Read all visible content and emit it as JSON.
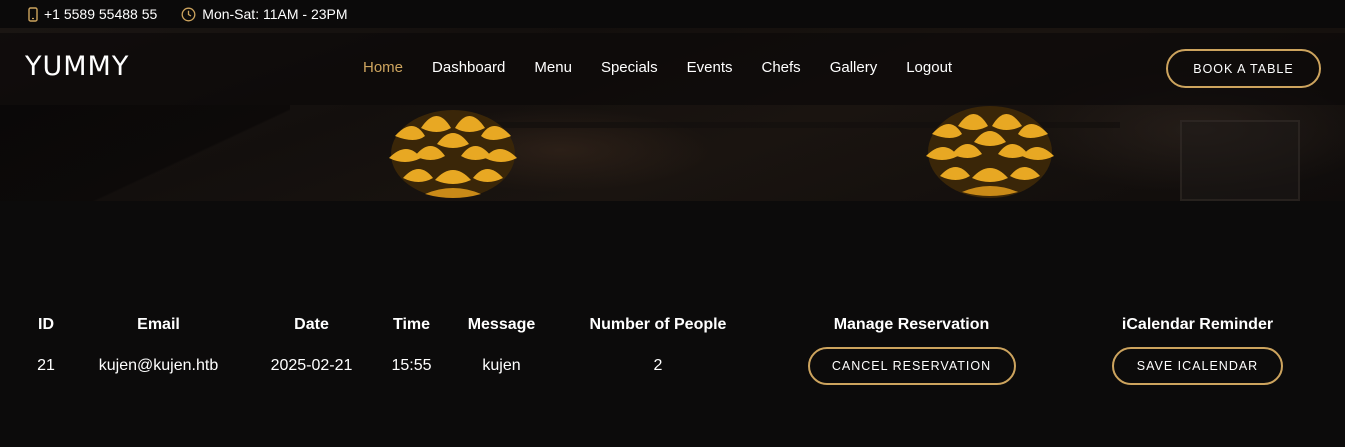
{
  "topbar": {
    "phone": "+1 5589 55488 55",
    "hours": "Mon-Sat: 11AM - 23PM"
  },
  "header": {
    "logo": "YUMMY",
    "nav": [
      {
        "label": "Home",
        "active": true
      },
      {
        "label": "Dashboard"
      },
      {
        "label": "Menu"
      },
      {
        "label": "Specials"
      },
      {
        "label": "Events"
      },
      {
        "label": "Chefs"
      },
      {
        "label": "Gallery"
      },
      {
        "label": "Logout"
      }
    ],
    "book_button": "BOOK A TABLE"
  },
  "table": {
    "headers": [
      "ID",
      "Email",
      "Date",
      "Time",
      "Message",
      "Number of People",
      "Manage Reservation",
      "iCalendar Reminder"
    ],
    "rows": [
      {
        "id": "21",
        "email": "kujen@kujen.htb",
        "date": "2025-02-21",
        "time": "15:55",
        "message": "kujen",
        "people": "2",
        "cancel_label": "CANCEL RESERVATION",
        "save_label": "SAVE ICALENDAR"
      }
    ]
  },
  "colors": {
    "accent": "#cda45e",
    "background": "#0c0b0b",
    "text": "#ffffff"
  },
  "icons": {
    "phone": "phone-icon",
    "hours": "clock-icon"
  }
}
